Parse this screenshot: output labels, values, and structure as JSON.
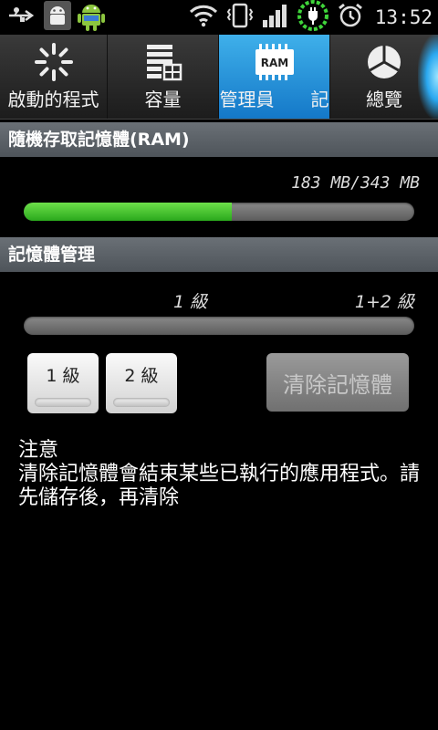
{
  "status_bar": {
    "time": "13:52",
    "icons": [
      "usb-icon",
      "android-debug-icon",
      "android-app-icon",
      "wifi-icon",
      "vibrate-icon",
      "signal-icon",
      "battery-charging-icon",
      "alarm-icon"
    ]
  },
  "tabs": [
    {
      "label": "啟動的程式",
      "icon": "spinner-icon",
      "active": false
    },
    {
      "label": "容量",
      "icon": "storage-icon",
      "active": false
    },
    {
      "label": "管理員",
      "icon": "ram-chip-icon",
      "icon_text": "RAM",
      "active": true
    },
    {
      "label": "記",
      "active": false
    },
    {
      "label": "總覽",
      "icon": "pie-chart-icon",
      "active": false
    }
  ],
  "ram_section": {
    "title": "隨機存取記憶體(RAM)",
    "usage_text": "183 MB/343 MB",
    "used_fraction": 0.533
  },
  "memory_section": {
    "title": "記憶體管理",
    "level_label_1": "1 級",
    "level_label_2": "1+2 級",
    "button_level1": "1 級",
    "button_level2": "2 級",
    "clear_button": "清除記憶體"
  },
  "note": {
    "title": "注意",
    "body": "清除記憶體會結束某些已執行的應用程式。請先儲存後，再清除"
  },
  "colors": {
    "accent": "#2a9be0",
    "bar_fill": "#3cc02a",
    "section_bg": "#5c6268"
  }
}
